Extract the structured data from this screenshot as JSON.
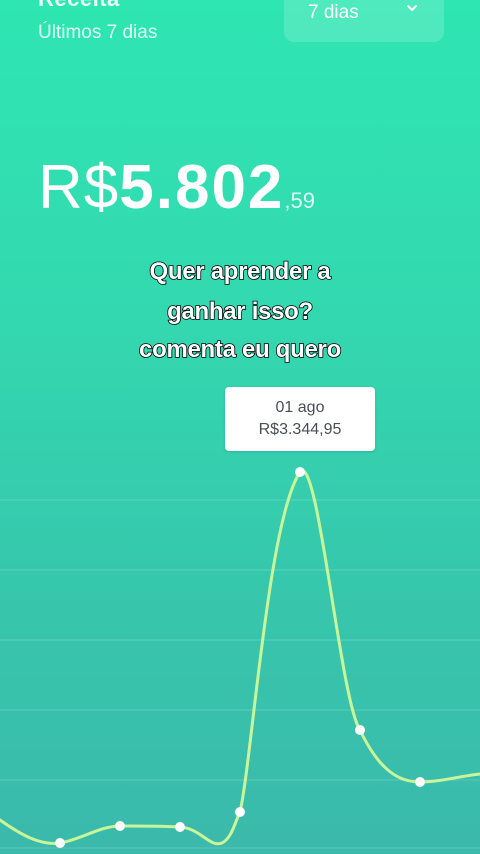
{
  "header": {
    "title": "Receita",
    "subtitle": "Últimos 7 dias",
    "period_select": {
      "value": "7 dias"
    }
  },
  "summary": {
    "currency": "R$",
    "integer": "5.802",
    "cents": ",59"
  },
  "overlay_caption": {
    "line1": "Quer aprender a",
    "line2": "ganhar isso?",
    "line3": "comenta eu quero"
  },
  "tooltip": {
    "date": "01 ago",
    "value": "R$3.344,95"
  },
  "colors": {
    "background_top": "#2ee6b2",
    "background_bottom": "#3bb9ab",
    "line": "#c9f59a",
    "point": "#ffffff"
  },
  "chart_data": {
    "type": "line",
    "series_values": [
      0,
      0,
      0,
      0,
      0,
      3344.95,
      0,
      0
    ]
  }
}
